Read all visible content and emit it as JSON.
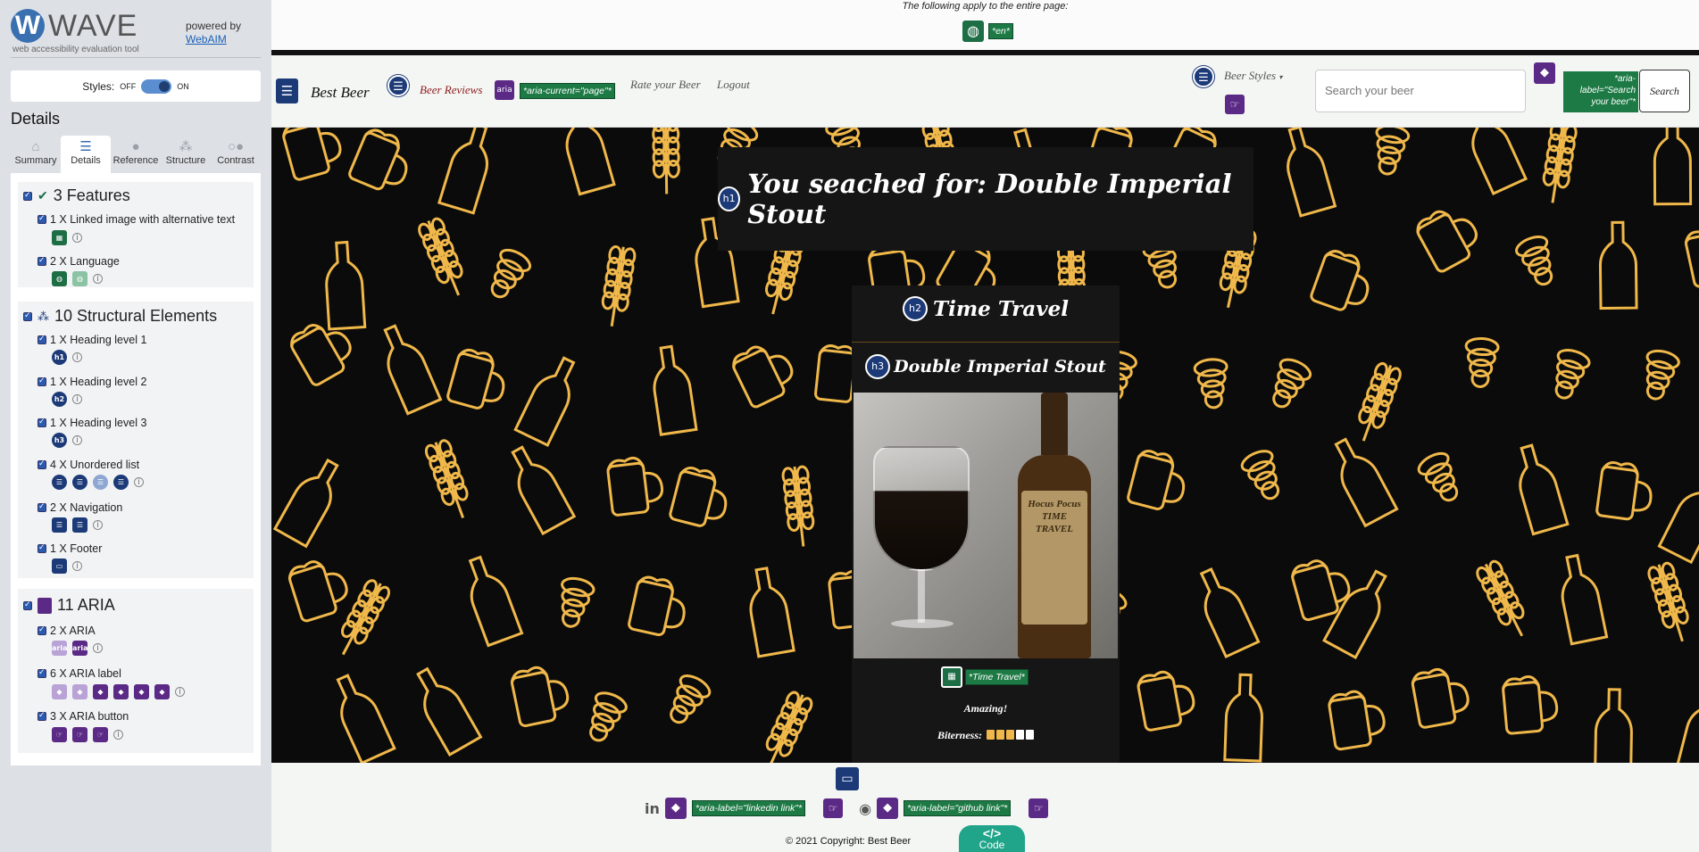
{
  "wave": {
    "logo_letter": "W",
    "title": "WAVE",
    "tagline": "web accessibility evaluation tool",
    "powered_by": "powered by",
    "webaim_link": "WebAIM",
    "styles_label": "Styles:",
    "styles_off": "OFF",
    "styles_on": "ON",
    "details_heading": "Details",
    "tabs": [
      {
        "label": "Summary",
        "icon": "home-icon"
      },
      {
        "label": "Details",
        "icon": "list-icon"
      },
      {
        "label": "Reference",
        "icon": "info-icon"
      },
      {
        "label": "Structure",
        "icon": "structure-icon"
      },
      {
        "label": "Contrast",
        "icon": "contrast-icon"
      }
    ],
    "groups": {
      "features": {
        "title": "3 Features",
        "items": [
          {
            "label": "1 X Linked image with alternative text"
          },
          {
            "label": "2 X Language"
          }
        ]
      },
      "structure": {
        "title": "10 Structural Elements",
        "items": [
          {
            "label": "1 X Heading level 1",
            "badge": "h1"
          },
          {
            "label": "1 X Heading level 2",
            "badge": "h2"
          },
          {
            "label": "1 X Heading level 3",
            "badge": "h3"
          },
          {
            "label": "4 X Unordered list"
          },
          {
            "label": "2 X Navigation"
          },
          {
            "label": "1 X Footer"
          }
        ]
      },
      "aria": {
        "title": "11 ARIA",
        "items": [
          {
            "label": "2 X ARIA",
            "badge": "aria"
          },
          {
            "label": "6 X ARIA label"
          },
          {
            "label": "3 X ARIA button"
          }
        ]
      }
    }
  },
  "page": {
    "notice": "The following apply to the entire page:",
    "lang_tag": "*en*",
    "nav": {
      "brand": "Best Beer",
      "links": [
        "Beer Reviews",
        "Rate your Beer",
        "Logout"
      ],
      "aria_current": "*aria-current=\"page\"*",
      "aria_badge": "aria",
      "dropdown": "Beer Styles",
      "search_placeholder": "Search your beer",
      "search_aria": "*aria-label=\"Search your beer\"*",
      "search_button": "Search"
    },
    "h1_badge": "h1",
    "h1": "You seached for: Double Imperial Stout",
    "card": {
      "h2_badge": "h2",
      "title": "Time Travel",
      "h3_badge": "h3",
      "style": "Double Imperial Stout",
      "bottle_label": "Hocus Pocus TIME TRAVEL",
      "alt_tag": "*Time Travel*",
      "review": "Amazing!",
      "bitterness_label": "Biterness:",
      "bitterness_value": 3,
      "bitterness_max": 5
    },
    "footer": {
      "linkedin_aria": "*aria-label=\"linkedin link\"*",
      "github_aria": "*aria-label=\"github link\"*",
      "copyright": "© 2021 Copyright: Best Beer",
      "code_button": "Code",
      "code_symbol": "</>"
    }
  },
  "colors": {
    "structure_blue": "#1c3a78",
    "feature_green": "#1d6e45",
    "aria_purple": "#5b2a86",
    "pattern_gold": "#f0b84a",
    "code_teal": "#20a58a"
  }
}
